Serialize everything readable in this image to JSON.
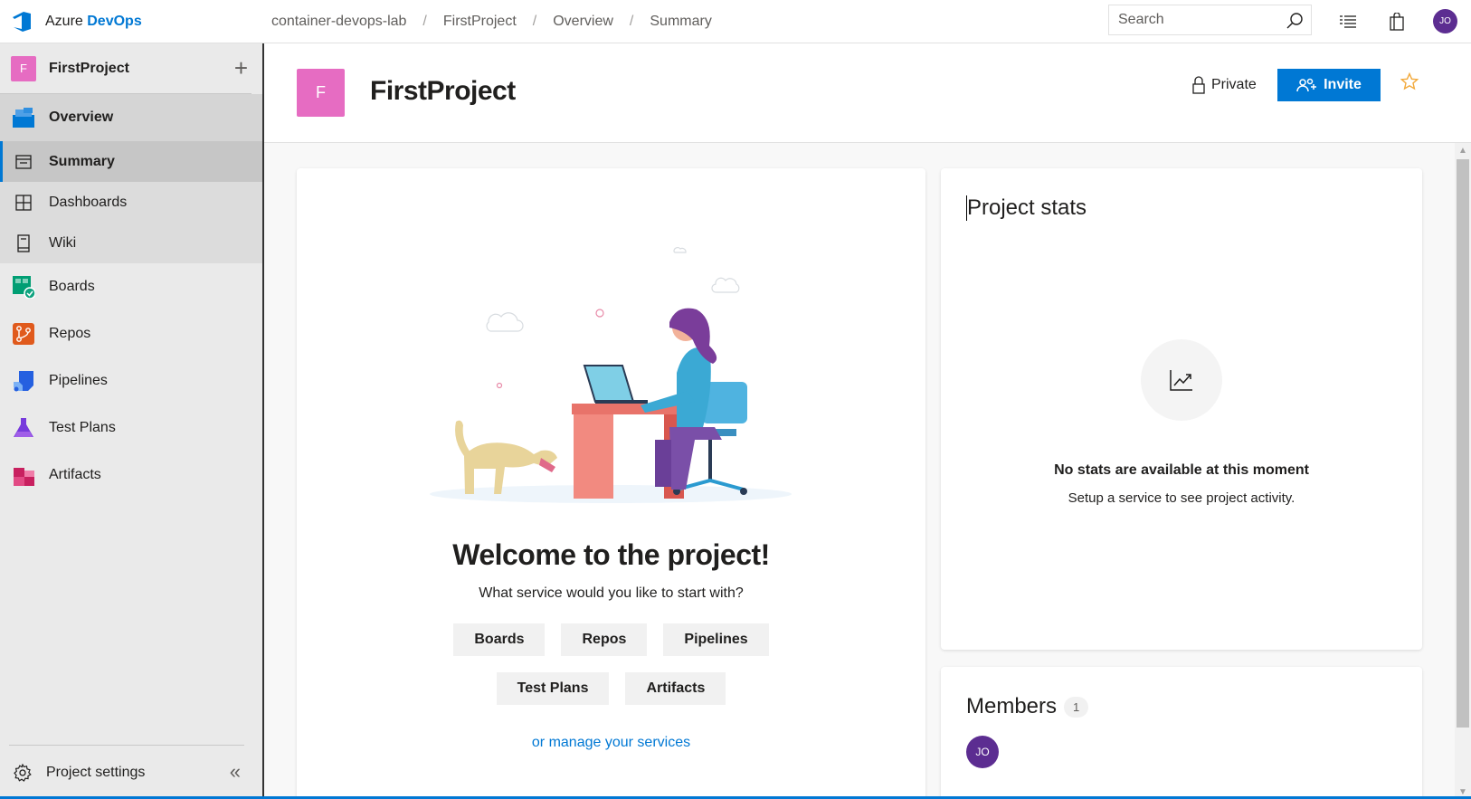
{
  "brand": {
    "name_part1": "Azure",
    "name_part2": "DevOps"
  },
  "breadcrumb": [
    "container-devops-lab",
    "FirstProject",
    "Overview",
    "Summary"
  ],
  "search": {
    "placeholder": "Search"
  },
  "user": {
    "initials": "JO"
  },
  "sidebar": {
    "project": {
      "badge": "F",
      "name": "FirstProject"
    },
    "items": [
      {
        "label": "Overview"
      },
      {
        "label": "Summary"
      },
      {
        "label": "Dashboards"
      },
      {
        "label": "Wiki"
      },
      {
        "label": "Boards"
      },
      {
        "label": "Repos"
      },
      {
        "label": "Pipelines"
      },
      {
        "label": "Test Plans"
      },
      {
        "label": "Artifacts"
      }
    ],
    "settings_label": "Project settings"
  },
  "header": {
    "badge": "F",
    "title": "FirstProject",
    "visibility": "Private",
    "invite_label": "Invite"
  },
  "welcome": {
    "title": "Welcome to the project!",
    "subtitle": "What service would you like to start with?",
    "services_row1": [
      "Boards",
      "Repos",
      "Pipelines"
    ],
    "services_row2": [
      "Test Plans",
      "Artifacts"
    ],
    "manage_link": "or manage your services"
  },
  "stats": {
    "title": "Project stats",
    "empty_title": "No stats are available at this moment",
    "empty_sub": "Setup a service to see project activity."
  },
  "members": {
    "title": "Members",
    "count": "1",
    "avatar": "JO"
  },
  "colors": {
    "accent": "#0078d4",
    "project_badge": "#e66cc2",
    "avatar": "#5c2d91",
    "star": "#f2a93b"
  }
}
